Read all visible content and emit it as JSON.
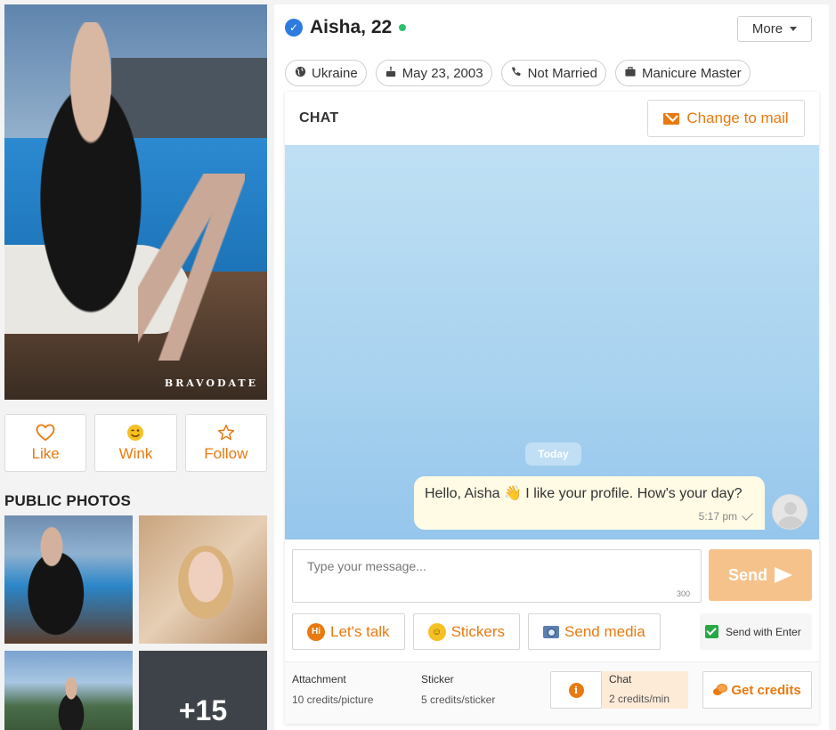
{
  "profile": {
    "name_age": "Aisha, 22",
    "online": true,
    "watermark": "BRAVODATE",
    "more_label": "More"
  },
  "actions": [
    {
      "label": "Like",
      "icon": "heart-icon"
    },
    {
      "label": "Wink",
      "icon": "wink-icon"
    },
    {
      "label": "Follow",
      "icon": "star-icon"
    }
  ],
  "photos": {
    "title": "PUBLIC PHOTOS",
    "more_count": "+15"
  },
  "chips": [
    {
      "label": "Ukraine",
      "icon": "globe-icon"
    },
    {
      "label": "May 23, 2003",
      "icon": "cake-icon"
    },
    {
      "label": "Not Married",
      "icon": "phone-icon"
    },
    {
      "label": "Manicure Master",
      "icon": "briefcase-icon"
    }
  ],
  "chat": {
    "title": "CHAT",
    "change_mail_label": "Change to mail",
    "day_label": "Today",
    "message": {
      "text": "Hello, Aisha 👋 I like your profile. How's your day?",
      "time": "5:17 pm",
      "status": "sent"
    },
    "input": {
      "placeholder": "Type your message...",
      "counter": "300"
    },
    "send_label": "Send",
    "tools": [
      {
        "label": "Let's talk",
        "icon": "hi-icon"
      },
      {
        "label": "Stickers",
        "icon": "sticker-icon"
      },
      {
        "label": "Send media",
        "icon": "camera-icon"
      }
    ],
    "send_with_enter": {
      "label": "Send with Enter",
      "checked": true
    }
  },
  "costs": {
    "attachment": {
      "label": "Attachment",
      "value": "10 credits/picture"
    },
    "sticker": {
      "label": "Sticker",
      "value": "5 credits/sticker"
    },
    "chat": {
      "label": "Chat",
      "value": "2 credits/min"
    },
    "get_credits_label": "Get credits"
  },
  "colors": {
    "accent": "#e87a10",
    "verified": "#2e7be0",
    "online": "#2cc06b",
    "send_button": "#f6c28b",
    "bubble": "#fffbe5",
    "chat_cost_bg": "#fdebd7"
  }
}
